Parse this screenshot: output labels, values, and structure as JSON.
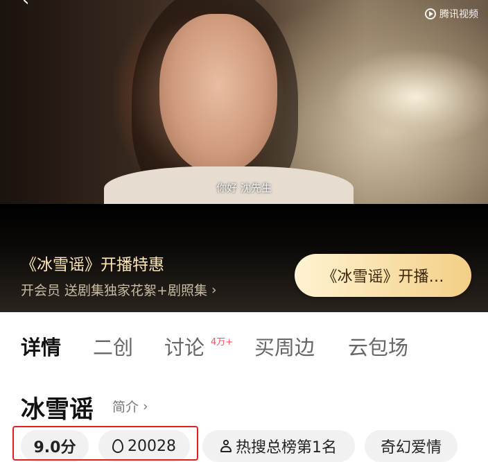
{
  "player": {
    "logo_text": "腾讯视频",
    "subtitle": "你好  沈先生"
  },
  "promo": {
    "title": "《冰雪谣》开播特惠",
    "subtitle": "开会员 送剧集独家花絮+剧照集",
    "subtitle_arrow": "›",
    "button_label": "《冰雪谣》开播…",
    "colors": {
      "title": "#ffe8b8",
      "button_gradient_start": "#fff3d2",
      "button_gradient_end": "#f3cf86"
    }
  },
  "tabs": {
    "items": [
      {
        "label": "详情",
        "active": true
      },
      {
        "label": "二创",
        "active": false
      },
      {
        "label": "讨论",
        "active": false
      },
      {
        "label": "买周边",
        "active": false
      },
      {
        "label": "云包场",
        "active": false
      }
    ],
    "discussion_badge": "4万+"
  },
  "show": {
    "title": "冰雪谣",
    "intro_label": "简介",
    "intro_arrow": "›"
  },
  "tags": {
    "score": "9.0分",
    "heat": "20028",
    "rank": "热搜总榜第1名",
    "genre": "奇幻爱情"
  }
}
